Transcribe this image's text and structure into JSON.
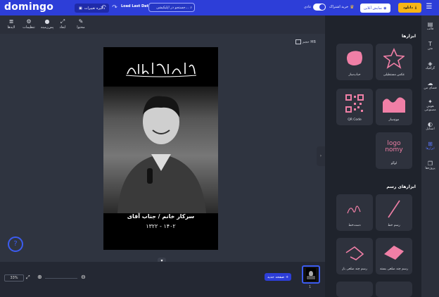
{
  "app": {
    "logo": "domingo"
  },
  "header": {
    "save_label": "ذخیره تغییرات",
    "load_last_label": "Load Last Data",
    "search_placeholder": "جستجو در اپلیکیشن...",
    "toggle_label": "عادی",
    "buy_subscription_label": "خرید اشتراک",
    "preview_label": "نمایش آنلاین",
    "download_label": "دانلود"
  },
  "toolbar": {
    "items": [
      {
        "label": "محتوا",
        "icon": "edit-icon"
      },
      {
        "label": "ابعاد",
        "icon": "resize-icon"
      },
      {
        "label": "پس‌زمینه",
        "icon": "background-icon"
      },
      {
        "label": "تنظیمات",
        "icon": "settings-icon"
      },
      {
        "label": "لایه‌ها",
        "icon": "layers-icon"
      }
    ],
    "size_label": "حجم MB"
  },
  "artboard": {
    "calligraphy_text": "إنا لله وإنا إليه راجعون",
    "caption_name": "سرکار خانم / جناب آقای",
    "caption_date": "۱۳۲۲ - ۱۴۰۲"
  },
  "bottom": {
    "zoom_value": "33%",
    "new_page_label": "صفحه جدید",
    "page_number": "1"
  },
  "panel": {
    "tools_title": "ابزارها",
    "tools": [
      {
        "label": "عکس مستطیلی",
        "icon": "star-icon"
      },
      {
        "label": "حباب‌ساز",
        "icon": "blob-icon"
      },
      {
        "label": "موج‌ساز",
        "icon": "wave-icon"
      },
      {
        "label": "QR Code",
        "icon": "qr-code-icon"
      },
      {
        "label": "لوگو",
        "icon": "logo-icon"
      }
    ],
    "logo_text_line1": "logo",
    "logo_text_line2": "nomy",
    "drawing_title": "ابزارهای رسم",
    "drawing_tools": [
      {
        "label": "رسم خط",
        "icon": "line-icon"
      },
      {
        "label": "دست‌خط",
        "icon": "signature-icon"
      },
      {
        "label": "رسم چند ضلعی بسته",
        "icon": "polygon-closed-icon"
      },
      {
        "label": "رسم چند ضلعی باز",
        "icon": "polygon-open-icon"
      }
    ]
  },
  "nav": {
    "items": [
      {
        "label": "قالب",
        "icon": "template-icon"
      },
      {
        "label": "متن",
        "icon": "text-icon"
      },
      {
        "label": "گرافیک",
        "icon": "graphics-icon"
      },
      {
        "label": "فضای من",
        "icon": "cloud-icon"
      },
      {
        "label": "هوش مصنوعی",
        "icon": "ai-wand-icon"
      },
      {
        "label": "استایل",
        "icon": "palette-icon"
      },
      {
        "label": "ابزارها",
        "icon": "tools-icon"
      },
      {
        "label": "پروژه‌ها",
        "icon": "projects-icon"
      }
    ],
    "active_index": 6
  },
  "colors": {
    "brand": "#2d3ed8",
    "accent_yellow": "#f7b515",
    "tile_pink": "#f07fa6"
  }
}
